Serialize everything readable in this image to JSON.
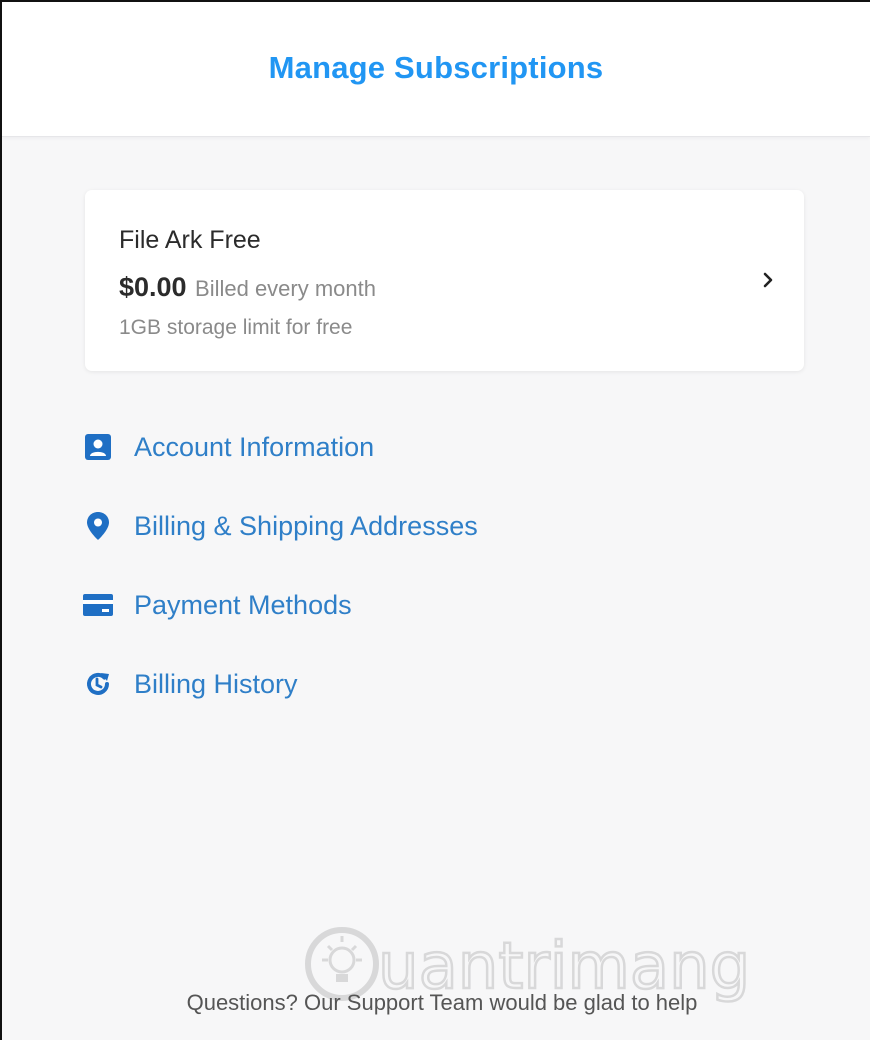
{
  "header": {
    "title": "Manage Subscriptions"
  },
  "plan": {
    "name": "File Ark Free",
    "price": "$0.00",
    "cycle": "Billed every month",
    "description": "1GB storage limit for free",
    "chevron_icon": "chevron-right-icon"
  },
  "menu": {
    "items": [
      {
        "label": "Account Information",
        "icon": "user-card-icon"
      },
      {
        "label": "Billing & Shipping Addresses",
        "icon": "map-pin-icon"
      },
      {
        "label": "Payment Methods",
        "icon": "credit-card-icon"
      },
      {
        "label": "Billing History",
        "icon": "history-icon"
      }
    ]
  },
  "footer": {
    "text": "Questions? Our Support Team would be glad to help"
  },
  "watermark": {
    "text": "uantrimang"
  },
  "colors": {
    "accent": "#2196f3",
    "link": "#2f7fc8",
    "icon": "#1f6fc4",
    "background": "#f7f7f8"
  }
}
